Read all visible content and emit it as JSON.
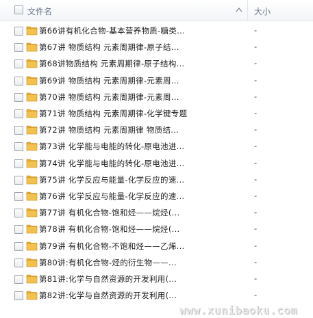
{
  "header": {
    "name_label": "文件名",
    "size_label": "大小"
  },
  "icons": {
    "folder": "folder-icon",
    "sort": "sort-arrow-up-icon",
    "checkbox": "checkbox"
  },
  "colors": {
    "folder_fill": "#f2c14e",
    "folder_tab": "#e8ad2f",
    "header_text": "#6d7a8a"
  },
  "files": [
    {
      "name": "第66讲有机化合物-基本营养物质-糖类...",
      "size": "-"
    },
    {
      "name": "第67讲 物质结构 元素周期律-原子结...",
      "size": "-"
    },
    {
      "name": "第68讲物质结构 元素周期律-原子结构...",
      "size": "-"
    },
    {
      "name": "第69讲 物质结构 元素周期律-元素周...",
      "size": "-"
    },
    {
      "name": "第70讲 物质结构 元素周期律-元素周...",
      "size": "-"
    },
    {
      "name": "第71讲 物质结构 元素周期律-化学键专题",
      "size": "-"
    },
    {
      "name": "第72讲 物质结构 元素周期律 物质结...",
      "size": "-"
    },
    {
      "name": "第73讲 化学能与电能的转化-原电池进...",
      "size": "-"
    },
    {
      "name": "第74讲 化学能与电能的转化-原电池进...",
      "size": "-"
    },
    {
      "name": "第75讲 化学反应与能量-化学反应的速...",
      "size": "-"
    },
    {
      "name": "第76讲 化学反应与能量-化学反应的速...",
      "size": "-"
    },
    {
      "name": "第77讲 有机化合物-饱和烃——烷烃(...",
      "size": "-"
    },
    {
      "name": "第78讲 有机化合物-饱和烃——烷烃(...",
      "size": "-"
    },
    {
      "name": "第79讲 有机化合物-不饱和烃——乙烯...",
      "size": "-"
    },
    {
      "name": "第80讲:有机化合物-烃的衍生物——...",
      "size": "-"
    },
    {
      "name": "第81讲:化学与自然资源的开发利用(...",
      "size": "-"
    },
    {
      "name": "第82讲:化学与自然资源的开发利用(...",
      "size": "-"
    }
  ],
  "watermark": "www.xunibaoku.com"
}
